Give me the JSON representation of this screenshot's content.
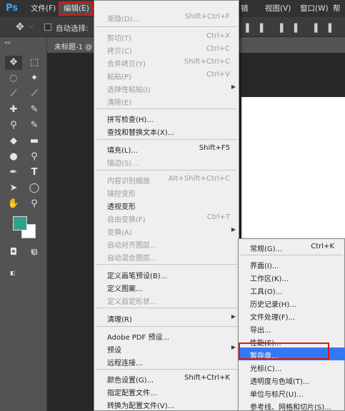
{
  "menubar": {
    "logo": "Ps",
    "items": [
      {
        "label": "文件(F)"
      },
      {
        "label": "编辑(E)"
      },
      {
        "label": "镜"
      },
      {
        "label": "视图(V)"
      },
      {
        "label": "窗口(W)"
      },
      {
        "label": "帮"
      }
    ]
  },
  "options": {
    "auto_select_label": "自动选择:"
  },
  "document": {
    "tab_label": "未标题-1 @"
  },
  "edit_menu": {
    "items": [
      {
        "label": "渐隐(D)...",
        "shortcut": "Shift+Ctrl+F",
        "disabled": true
      },
      {
        "label": "剪切(T)",
        "shortcut": "Ctrl+X",
        "disabled": true
      },
      {
        "label": "拷贝(C)",
        "shortcut": "Ctrl+C",
        "disabled": true
      },
      {
        "label": "合并拷贝(Y)",
        "shortcut": "Shift+Ctrl+C",
        "disabled": true
      },
      {
        "label": "粘贴(P)",
        "shortcut": "Ctrl+V",
        "disabled": true
      },
      {
        "label": "选择性粘贴(I)",
        "shortcut": "",
        "disabled": true,
        "submenu": true
      },
      {
        "label": "清除(E)",
        "shortcut": "",
        "disabled": true
      },
      {
        "label": "拼写检查(H)...",
        "shortcut": "",
        "disabled": false
      },
      {
        "label": "查找和替换文本(X)...",
        "shortcut": "",
        "disabled": false
      },
      {
        "label": "填充(L)...",
        "shortcut": "Shift+F5",
        "disabled": false
      },
      {
        "label": "描边(S)...",
        "shortcut": "",
        "disabled": true
      },
      {
        "label": "内容识别缩放",
        "shortcut": "Alt+Shift+Ctrl+C",
        "disabled": true
      },
      {
        "label": "操控变形",
        "shortcut": "",
        "disabled": true
      },
      {
        "label": "透视变形",
        "shortcut": "",
        "disabled": false
      },
      {
        "label": "自由变换(F)",
        "shortcut": "Ctrl+T",
        "disabled": true
      },
      {
        "label": "变换(A)",
        "shortcut": "",
        "disabled": true,
        "submenu": true
      },
      {
        "label": "自动对齐图层...",
        "shortcut": "",
        "disabled": true
      },
      {
        "label": "自动混合图层...",
        "shortcut": "",
        "disabled": true
      },
      {
        "label": "定义画笔预设(B)...",
        "shortcut": "",
        "disabled": false
      },
      {
        "label": "定义图案...",
        "shortcut": "",
        "disabled": false
      },
      {
        "label": "定义自定形状...",
        "shortcut": "",
        "disabled": true
      },
      {
        "label": "清理(R)",
        "shortcut": "",
        "disabled": false,
        "submenu": true
      },
      {
        "label": "Adobe PDF 预设...",
        "shortcut": "",
        "disabled": false
      },
      {
        "label": "预设",
        "shortcut": "",
        "disabled": false,
        "submenu": true
      },
      {
        "label": "远程连接...",
        "shortcut": "",
        "disabled": false
      },
      {
        "label": "颜色设置(G)...",
        "shortcut": "Shift+Ctrl+K",
        "disabled": false
      },
      {
        "label": "指定配置文件...",
        "shortcut": "",
        "disabled": false
      },
      {
        "label": "转换为配置文件(V)...",
        "shortcut": "",
        "disabled": false
      }
    ]
  },
  "prefs_menu": {
    "items": [
      {
        "label": "常规(G)...",
        "shortcut": "Ctrl+K"
      },
      {
        "label": "界面(I)...",
        "shortcut": ""
      },
      {
        "label": "工作区(K)...",
        "shortcut": ""
      },
      {
        "label": "工具(O)...",
        "shortcut": ""
      },
      {
        "label": "历史记录(H)...",
        "shortcut": ""
      },
      {
        "label": "文件处理(F)...",
        "shortcut": ""
      },
      {
        "label": "导出...",
        "shortcut": ""
      },
      {
        "label": "性能(E)...",
        "shortcut": ""
      },
      {
        "label": "暂存盘...",
        "shortcut": "",
        "highlighted": true
      },
      {
        "label": "光标(C)...",
        "shortcut": ""
      },
      {
        "label": "透明度与色域(T)...",
        "shortcut": ""
      },
      {
        "label": "单位与标尺(U)...",
        "shortcut": ""
      },
      {
        "label": "参考线、网格和切片(S)...",
        "shortcut": ""
      }
    ]
  },
  "colors": {
    "foreground": "#2ba38c",
    "background": "#ffffff",
    "highlight": "#3478f6",
    "annotation": "#d31b1b"
  }
}
